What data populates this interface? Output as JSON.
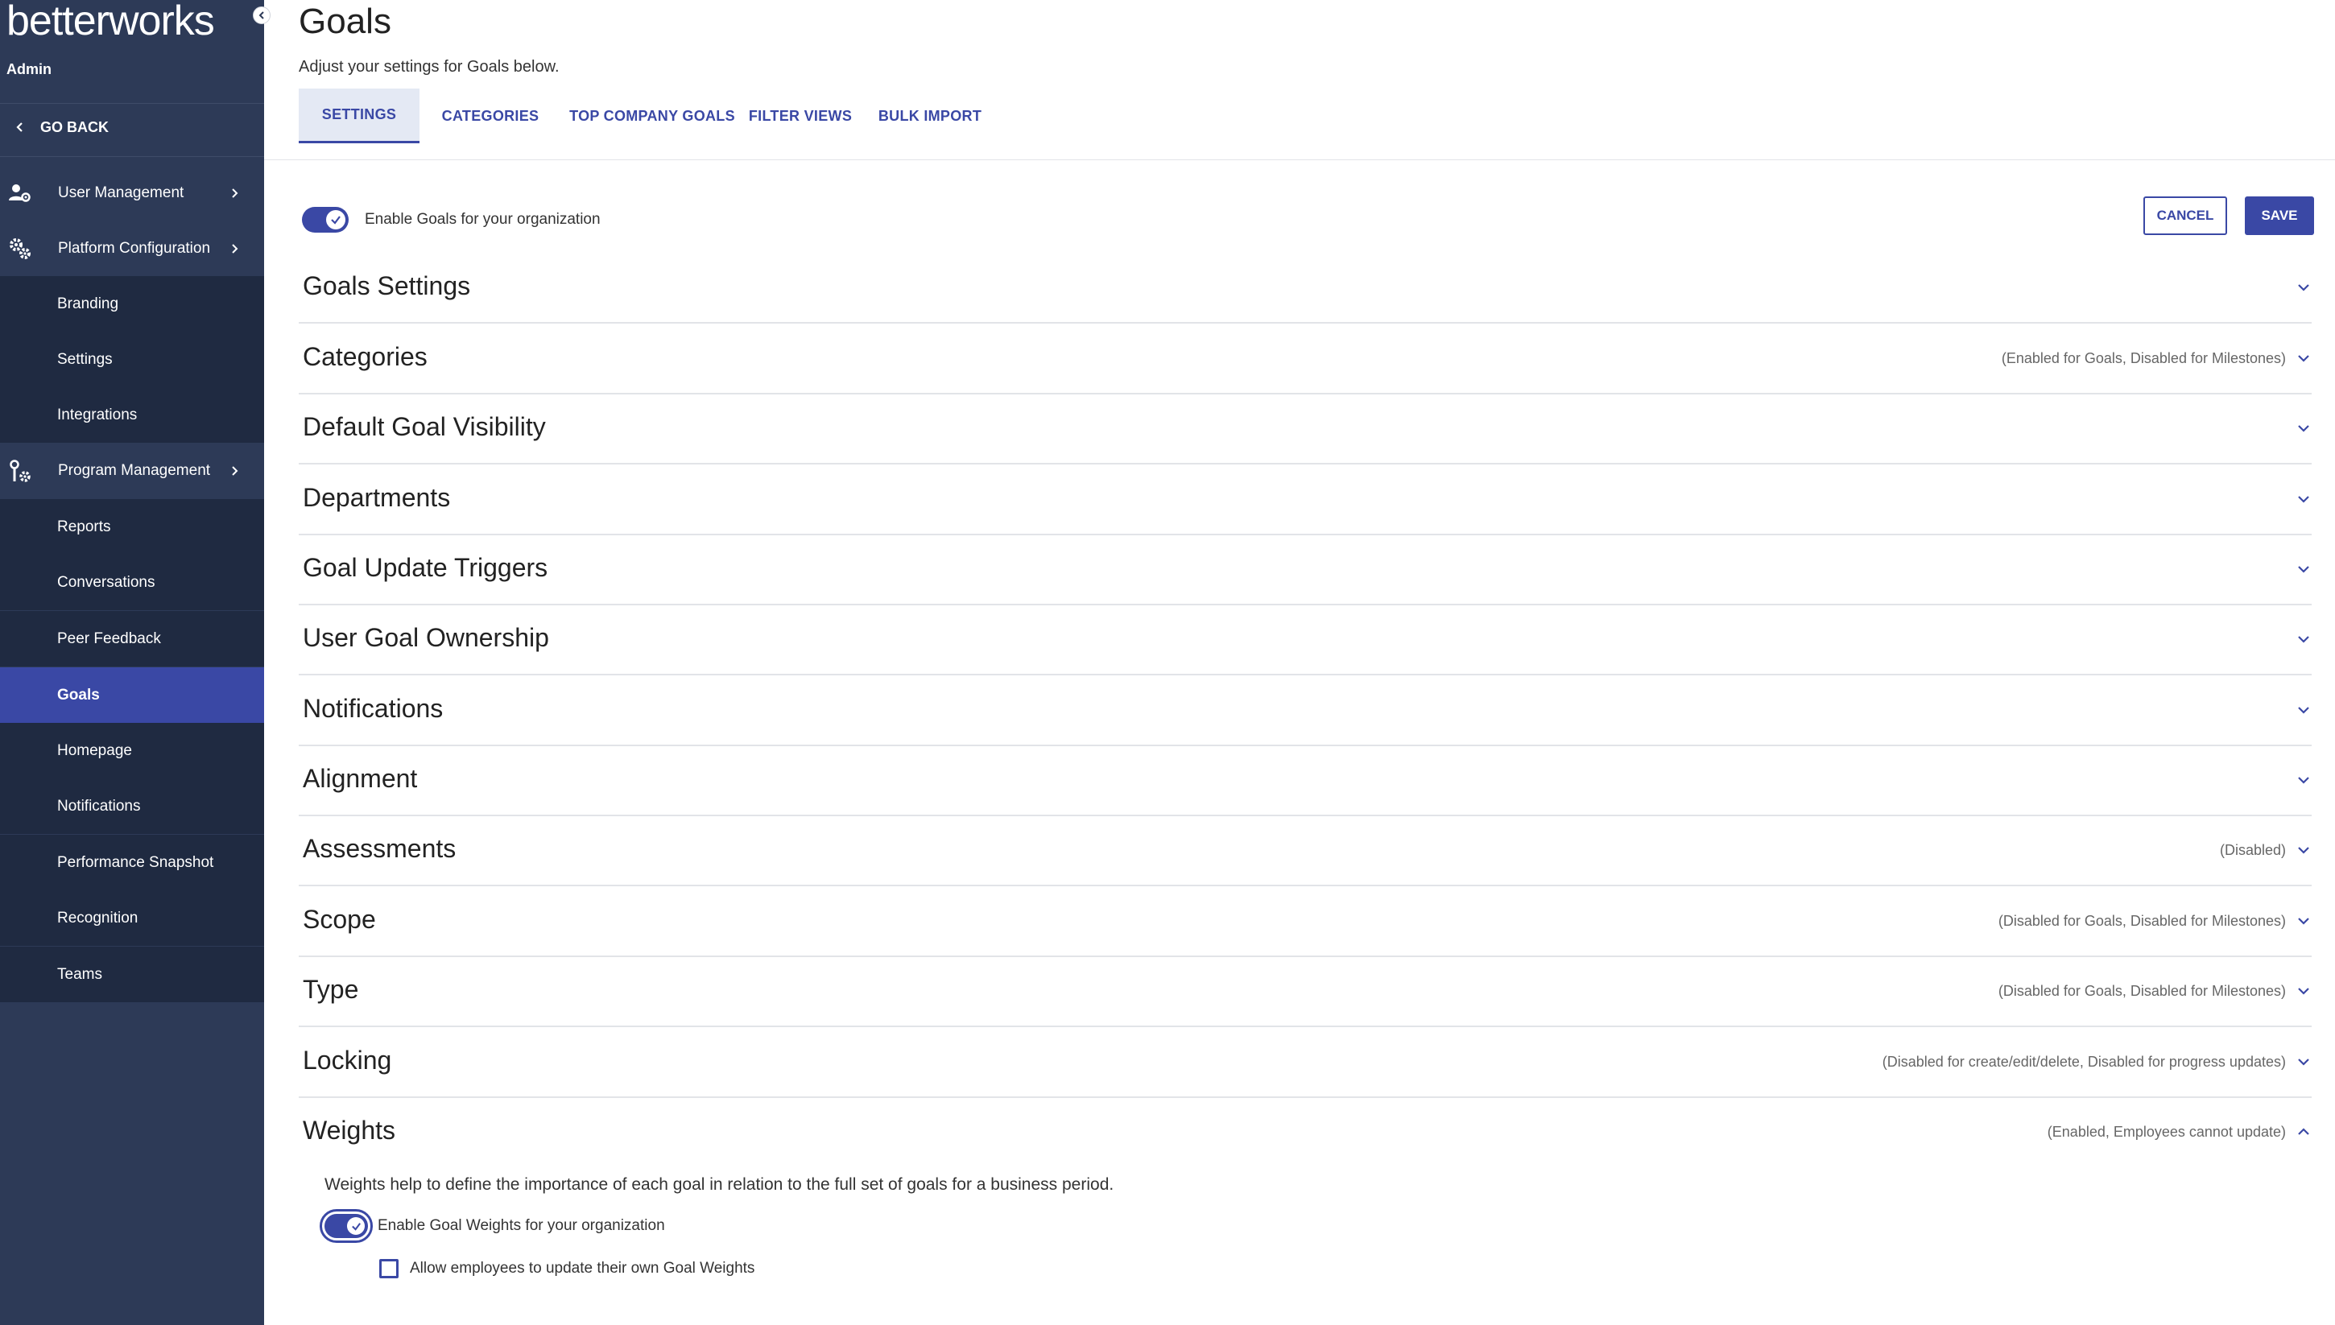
{
  "app": {
    "brand": "betterworks",
    "role": "Admin"
  },
  "sidebar": {
    "go_back": "GO BACK",
    "sections": [
      {
        "label": "User Management",
        "icon": "user-gear-icon"
      },
      {
        "label": "Platform Configuration",
        "icon": "gears-icon"
      },
      {
        "label": "Program Management",
        "icon": "program-icon"
      }
    ],
    "platform_items": [
      "Branding",
      "Settings",
      "Integrations"
    ],
    "program_items": [
      "Reports",
      "Conversations",
      "Peer Feedback",
      "Goals",
      "Homepage",
      "Notifications",
      "Performance Snapshot",
      "Recognition",
      "Teams"
    ],
    "active_item": "Goals"
  },
  "header": {
    "title": "Goals",
    "subtitle": "Adjust your settings for Goals below."
  },
  "tabs": [
    "SETTINGS",
    "CATEGORIES",
    "TOP COMPANY GOALS",
    "FILTER VIEWS",
    "BULK IMPORT"
  ],
  "active_tab": "SETTINGS",
  "enable_goals": {
    "label": "Enable Goals for your organization",
    "enabled": true
  },
  "actions": {
    "cancel": "CANCEL",
    "save": "SAVE"
  },
  "sections": [
    {
      "title": "Goals Settings",
      "status": ""
    },
    {
      "title": "Categories",
      "status": "(Enabled for Goals, Disabled for Milestones)"
    },
    {
      "title": "Default Goal Visibility",
      "status": ""
    },
    {
      "title": "Departments",
      "status": ""
    },
    {
      "title": "Goal Update Triggers",
      "status": ""
    },
    {
      "title": "User Goal Ownership",
      "status": ""
    },
    {
      "title": "Notifications",
      "status": ""
    },
    {
      "title": "Alignment",
      "status": ""
    },
    {
      "title": "Assessments",
      "status": "(Disabled)"
    },
    {
      "title": "Scope",
      "status": "(Disabled for Goals, Disabled for Milestones)"
    },
    {
      "title": "Type",
      "status": "(Disabled for Goals, Disabled for Milestones)"
    },
    {
      "title": "Locking",
      "status": "(Disabled for create/edit/delete, Disabled for progress updates)"
    },
    {
      "title": "Weights",
      "status": "(Enabled, Employees cannot update)",
      "expanded": true
    }
  ],
  "weights": {
    "description": "Weights help to define the importance of each goal in relation to the full set of goals for a business period.",
    "enable_label": "Enable Goal Weights for your organization",
    "enabled": true,
    "allow_label": "Allow employees to update their own Goal Weights",
    "allow_checked": false
  },
  "colors": {
    "primary": "#3a48a5",
    "sidebar": "#2d3a57",
    "sidebar_sub": "#1f2a41"
  }
}
